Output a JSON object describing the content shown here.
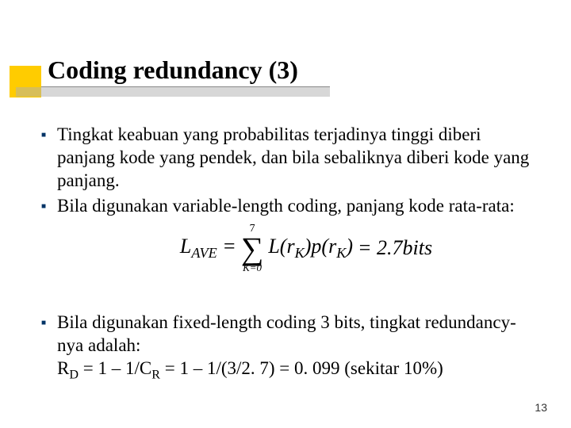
{
  "slide": {
    "title": "Coding redundancy (3)",
    "bullets": [
      "Tingkat keabuan yang probabilitas terjadinya tinggi diberi panjang kode yang pendek, dan bila sebaliknya diberi kode yang panjang.",
      "Bila digunakan variable-length coding, panjang kode rata-rata:",
      "Bila digunakan fixed-length coding 3 bits, tingkat redundancy-nya adalah:"
    ],
    "formula_lhs": "L",
    "formula_lhs_sub": "AVE",
    "formula_sigma_top": "7",
    "formula_sigma_bot": "K=0",
    "formula_term1": "L(r",
    "formula_term1_sub": "K",
    "formula_term1_close": ")",
    "formula_term2": "p(r",
    "formula_term2_sub": "K",
    "formula_term2_close": ")",
    "formula_rhs": "= 2.7bits",
    "redundancy_line": "R",
    "redundancy_sub_d": "D",
    "redundancy_mid": " = 1 – 1/C",
    "redundancy_sub_r": "R",
    "redundancy_tail": " = 1 – 1/(3/2. 7) = 0. 099 (sekitar 10%)",
    "page_number": "13"
  }
}
